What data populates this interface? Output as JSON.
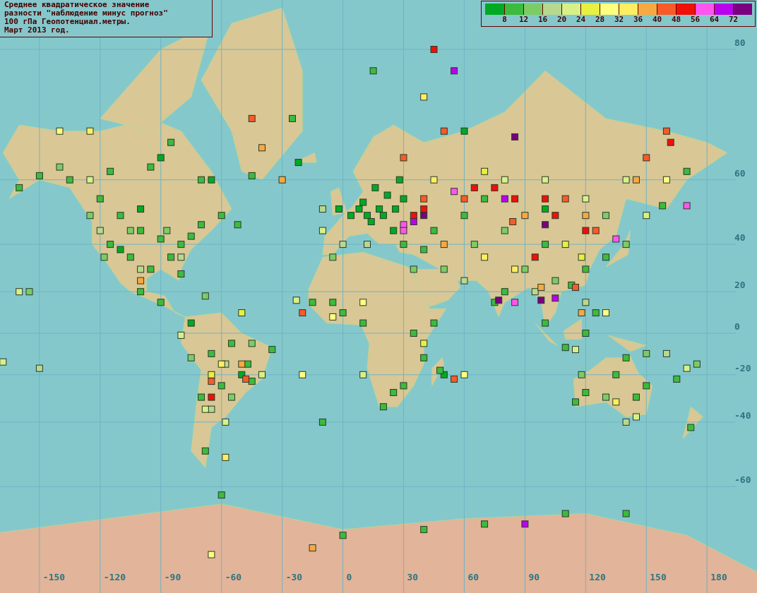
{
  "title": {
    "lines": [
      "Среднее квадратическое значение",
      "разности \"наблюдение минус прогноз\"",
      "100 гПа Геопотенциал.метры.",
      "Март 2013 год."
    ]
  },
  "legend": {
    "swatches": [
      {
        "color": "#00aa22"
      },
      {
        "color": "#3cbb3c"
      },
      {
        "color": "#7ccc66"
      },
      {
        "color": "#b8d890"
      },
      {
        "color": "#d8f088"
      },
      {
        "color": "#e8f040"
      },
      {
        "color": "#ffff80"
      },
      {
        "color": "#ffee60"
      },
      {
        "color": "#f8a840"
      },
      {
        "color": "#f85a28"
      },
      {
        "color": "#f01008"
      },
      {
        "color": "#ff55ee"
      },
      {
        "color": "#bb00ee"
      },
      {
        "color": "#7a0080"
      }
    ],
    "labels": [
      "8",
      "12",
      "16",
      "20",
      "24",
      "28",
      "32",
      "36",
      "40",
      "48",
      "56",
      "64",
      "72"
    ]
  },
  "map": {
    "longitude_labels": [
      "-150",
      "-120",
      "-90",
      "-60",
      "-30",
      "0",
      "30",
      "60",
      "90",
      "120",
      "150",
      "180"
    ],
    "latitude_labels": [
      "80",
      "60",
      "40",
      "20",
      "0",
      "-20",
      "-40",
      "-60"
    ],
    "stations": [
      {
        "color": "#00aa22"
      },
      {
        "color": "#00aa22"
      },
      {
        "color": "#00aa22"
      },
      {
        "color": "#00aa22"
      },
      {
        "color": "#00aa22"
      },
      {
        "color": "#00aa22"
      },
      {
        "color": "#00aa22"
      },
      {
        "color": "#00aa22"
      },
      {
        "color": "#00aa22"
      },
      {
        "color": "#00aa22"
      },
      {
        "color": "#00aa22"
      },
      {
        "color": "#00aa22"
      },
      {
        "color": "#00aa22"
      },
      {
        "color": "#00aa22"
      },
      {
        "color": "#00aa22"
      },
      {
        "color": "#00aa22"
      },
      {
        "color": "#00aa22"
      },
      {
        "color": "#00aa22"
      },
      {
        "color": "#00aa22"
      },
      {
        "color": "#00aa22"
      },
      {
        "color": "#00aa22"
      },
      {
        "color": "#00aa22"
      },
      {
        "color": "#00aa22"
      },
      {
        "color": "#00aa22"
      },
      {
        "color": "#3cbb3c"
      },
      {
        "color": "#3cbb3c"
      },
      {
        "color": "#3cbb3c"
      },
      {
        "color": "#3cbb3c"
      },
      {
        "color": "#3cbb3c"
      },
      {
        "color": "#3cbb3c"
      },
      {
        "color": "#3cbb3c"
      },
      {
        "color": "#3cbb3c"
      },
      {
        "color": "#3cbb3c"
      },
      {
        "color": "#3cbb3c"
      },
      {
        "color": "#3cbb3c"
      },
      {
        "color": "#3cbb3c"
      },
      {
        "color": "#3cbb3c"
      },
      {
        "color": "#3cbb3c"
      },
      {
        "color": "#3cbb3c"
      },
      {
        "color": "#3cbb3c"
      },
      {
        "color": "#3cbb3c"
      },
      {
        "color": "#3cbb3c"
      },
      {
        "color": "#3cbb3c"
      },
      {
        "color": "#3cbb3c"
      },
      {
        "color": "#3cbb3c"
      },
      {
        "color": "#3cbb3c"
      },
      {
        "color": "#3cbb3c"
      },
      {
        "color": "#3cbb3c"
      },
      {
        "color": "#3cbb3c"
      },
      {
        "color": "#3cbb3c"
      },
      {
        "color": "#3cbb3c"
      },
      {
        "color": "#3cbb3c"
      },
      {
        "color": "#3cbb3c"
      },
      {
        "color": "#3cbb3c"
      },
      {
        "color": "#3cbb3c"
      },
      {
        "color": "#3cbb3c"
      },
      {
        "color": "#3cbb3c"
      },
      {
        "color": "#3cbb3c"
      },
      {
        "color": "#3cbb3c"
      },
      {
        "color": "#3cbb3c"
      },
      {
        "color": "#3cbb3c"
      },
      {
        "color": "#3cbb3c"
      },
      {
        "color": "#3cbb3c"
      },
      {
        "color": "#3cbb3c"
      },
      {
        "color": "#3cbb3c"
      },
      {
        "color": "#3cbb3c"
      },
      {
        "color": "#3cbb3c"
      },
      {
        "color": "#3cbb3c"
      },
      {
        "color": "#3cbb3c"
      },
      {
        "color": "#3cbb3c"
      },
      {
        "color": "#3cbb3c"
      },
      {
        "color": "#3cbb3c"
      },
      {
        "color": "#3cbb3c"
      },
      {
        "color": "#3cbb3c"
      },
      {
        "color": "#3cbb3c"
      },
      {
        "color": "#3cbb3c"
      },
      {
        "color": "#3cbb3c"
      },
      {
        "color": "#3cbb3c"
      },
      {
        "color": "#3cbb3c"
      },
      {
        "color": "#3cbb3c"
      },
      {
        "color": "#3cbb3c"
      },
      {
        "color": "#3cbb3c"
      },
      {
        "color": "#3cbb3c"
      },
      {
        "color": "#3cbb3c"
      },
      {
        "color": "#3cbb3c"
      },
      {
        "color": "#3cbb3c"
      },
      {
        "color": "#3cbb3c"
      },
      {
        "color": "#3cbb3c"
      },
      {
        "color": "#3cbb3c"
      },
      {
        "color": "#3cbb3c"
      },
      {
        "color": "#3cbb3c"
      },
      {
        "color": "#3cbb3c"
      },
      {
        "color": "#3cbb3c"
      },
      {
        "color": "#3cbb3c"
      },
      {
        "color": "#3cbb3c"
      },
      {
        "color": "#3cbb3c"
      },
      {
        "color": "#3cbb3c"
      },
      {
        "color": "#3cbb3c"
      },
      {
        "color": "#3cbb3c"
      },
      {
        "color": "#3cbb3c"
      },
      {
        "color": "#3cbb3c"
      },
      {
        "color": "#7ccc66"
      },
      {
        "color": "#7ccc66"
      },
      {
        "color": "#7ccc66"
      },
      {
        "color": "#7ccc66"
      },
      {
        "color": "#7ccc66"
      },
      {
        "color": "#7ccc66"
      },
      {
        "color": "#7ccc66"
      },
      {
        "color": "#7ccc66"
      },
      {
        "color": "#7ccc66"
      },
      {
        "color": "#7ccc66"
      },
      {
        "color": "#7ccc66"
      },
      {
        "color": "#7ccc66"
      },
      {
        "color": "#7ccc66"
      },
      {
        "color": "#7ccc66"
      },
      {
        "color": "#7ccc66"
      },
      {
        "color": "#7ccc66"
      },
      {
        "color": "#7ccc66"
      },
      {
        "color": "#7ccc66"
      },
      {
        "color": "#7ccc66"
      },
      {
        "color": "#7ccc66"
      },
      {
        "color": "#7ccc66"
      },
      {
        "color": "#7ccc66"
      },
      {
        "color": "#7ccc66"
      },
      {
        "color": "#b8d890"
      },
      {
        "color": "#b8d890"
      },
      {
        "color": "#b8d890"
      },
      {
        "color": "#b8d890"
      },
      {
        "color": "#b8d890"
      },
      {
        "color": "#b8d890"
      },
      {
        "color": "#b8d890"
      },
      {
        "color": "#b8d890"
      },
      {
        "color": "#b8d890"
      },
      {
        "color": "#b8d890"
      },
      {
        "color": "#b8d890"
      },
      {
        "color": "#b8d890"
      },
      {
        "color": "#b8d890"
      },
      {
        "color": "#b8d890"
      },
      {
        "color": "#d8f088"
      },
      {
        "color": "#d8f088"
      },
      {
        "color": "#d8f088"
      },
      {
        "color": "#d8f088"
      },
      {
        "color": "#d8f088"
      },
      {
        "color": "#d8f088"
      },
      {
        "color": "#d8f088"
      },
      {
        "color": "#d8f088"
      },
      {
        "color": "#d8f088"
      },
      {
        "color": "#d8f088"
      },
      {
        "color": "#d8f088"
      },
      {
        "color": "#d8f088"
      },
      {
        "color": "#d8f088"
      },
      {
        "color": "#d8f088"
      },
      {
        "color": "#d8f088"
      },
      {
        "color": "#d8f088"
      },
      {
        "color": "#d8f088"
      },
      {
        "color": "#d8f088"
      },
      {
        "color": "#e8f040"
      },
      {
        "color": "#e8f040"
      },
      {
        "color": "#e8f040"
      },
      {
        "color": "#e8f040"
      },
      {
        "color": "#e8f040"
      },
      {
        "color": "#e8f040"
      },
      {
        "color": "#ffff80"
      },
      {
        "color": "#ffff80"
      },
      {
        "color": "#ffff80"
      },
      {
        "color": "#ffff80"
      },
      {
        "color": "#ffff80"
      },
      {
        "color": "#ffff80"
      },
      {
        "color": "#ffff80"
      },
      {
        "color": "#ffff80"
      },
      {
        "color": "#ffee60"
      },
      {
        "color": "#ffee60"
      },
      {
        "color": "#ffee60"
      },
      {
        "color": "#ffee60"
      },
      {
        "color": "#ffee60"
      },
      {
        "color": "#ffee60"
      },
      {
        "color": "#ffee60"
      },
      {
        "color": "#ffee60"
      },
      {
        "color": "#f8a840"
      },
      {
        "color": "#f8a840"
      },
      {
        "color": "#f8a840"
      },
      {
        "color": "#f8a840"
      },
      {
        "color": "#f8a840"
      },
      {
        "color": "#f8a840"
      },
      {
        "color": "#f8a840"
      },
      {
        "color": "#f8a840"
      },
      {
        "color": "#f8a840"
      },
      {
        "color": "#f8a840"
      },
      {
        "color": "#f8a840"
      },
      {
        "color": "#f85a28"
      },
      {
        "color": "#f85a28"
      },
      {
        "color": "#f85a28"
      },
      {
        "color": "#f85a28"
      },
      {
        "color": "#f85a28"
      },
      {
        "color": "#f85a28"
      },
      {
        "color": "#f85a28"
      },
      {
        "color": "#f85a28"
      },
      {
        "color": "#f85a28"
      },
      {
        "color": "#f85a28"
      },
      {
        "color": "#f85a28"
      },
      {
        "color": "#f85a28"
      },
      {
        "color": "#f85a28"
      },
      {
        "color": "#f85a28"
      },
      {
        "color": "#f85a28"
      },
      {
        "color": "#f01008"
      },
      {
        "color": "#f01008"
      },
      {
        "color": "#f01008"
      },
      {
        "color": "#f01008"
      },
      {
        "color": "#f01008"
      },
      {
        "color": "#f01008"
      },
      {
        "color": "#f01008"
      },
      {
        "color": "#f01008"
      },
      {
        "color": "#f01008"
      },
      {
        "color": "#f01008"
      },
      {
        "color": "#f01008"
      },
      {
        "color": "#f01008"
      },
      {
        "color": "#ff55ee"
      },
      {
        "color": "#ff55ee"
      },
      {
        "color": "#ff55ee"
      },
      {
        "color": "#ff55ee"
      },
      {
        "color": "#ff55ee"
      },
      {
        "color": "#ff55ee"
      },
      {
        "color": "#bb00ee"
      },
      {
        "color": "#bb00ee"
      },
      {
        "color": "#bb00ee"
      },
      {
        "color": "#bb00ee"
      },
      {
        "color": "#bb00ee"
      },
      {
        "color": "#7a0080"
      },
      {
        "color": "#7a0080"
      },
      {
        "color": "#7a0080"
      },
      {
        "color": "#7a0080"
      },
      {
        "color": "#7a0080"
      }
    ]
  }
}
